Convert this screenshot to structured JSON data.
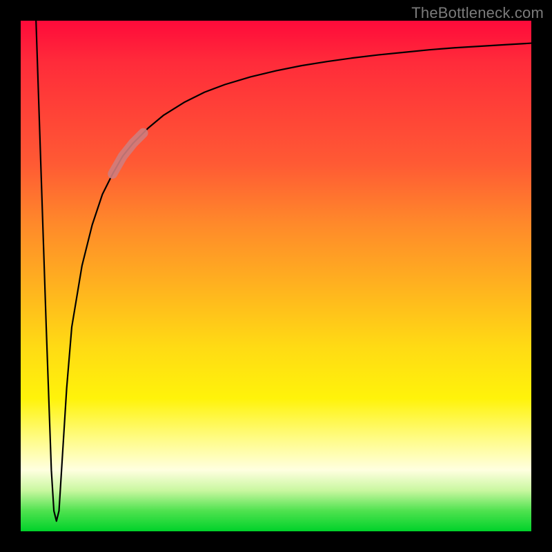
{
  "attribution": "TheBottleneck.com",
  "colors": {
    "frame": "#000000",
    "curve": "#000000",
    "highlight": "#cf7d7d",
    "gradient_top": "#ff0a3a",
    "gradient_bottom": "#00d22a"
  },
  "chart_data": {
    "type": "line",
    "title": "",
    "xlabel": "",
    "ylabel": "",
    "xlim": [
      0,
      100
    ],
    "ylim": [
      0,
      100
    ],
    "grid": false,
    "legend": false,
    "series": [
      {
        "name": "bottleneck-curve",
        "x": [
          3,
          4,
          5,
          6,
          6.5,
          7,
          7.5,
          8,
          9,
          10,
          12,
          14,
          16,
          18,
          20,
          22,
          25,
          28,
          32,
          36,
          40,
          45,
          50,
          55,
          60,
          65,
          70,
          75,
          80,
          85,
          90,
          95,
          100
        ],
        "y": [
          100,
          70,
          40,
          12,
          4,
          2,
          4,
          12,
          28,
          40,
          52,
          60,
          66,
          70,
          73.5,
          76,
          79,
          81.5,
          84,
          86,
          87.5,
          89,
          90.2,
          91.2,
          92,
          92.7,
          93.3,
          93.8,
          94.3,
          94.7,
          95,
          95.3,
          95.6
        ]
      }
    ],
    "highlight_segment": {
      "series": "bottleneck-curve",
      "x_start": 18,
      "x_end": 24,
      "note": "thick reddish segment overlaid on curve"
    },
    "background_gradient": {
      "orientation": "vertical",
      "stops": [
        {
          "pos": 0.0,
          "color": "#ff0a3a"
        },
        {
          "pos": 0.4,
          "color": "#ff8a2a"
        },
        {
          "pos": 0.7,
          "color": "#fff30a"
        },
        {
          "pos": 0.88,
          "color": "#ffffe0"
        },
        {
          "pos": 1.0,
          "color": "#00d22a"
        }
      ]
    }
  }
}
